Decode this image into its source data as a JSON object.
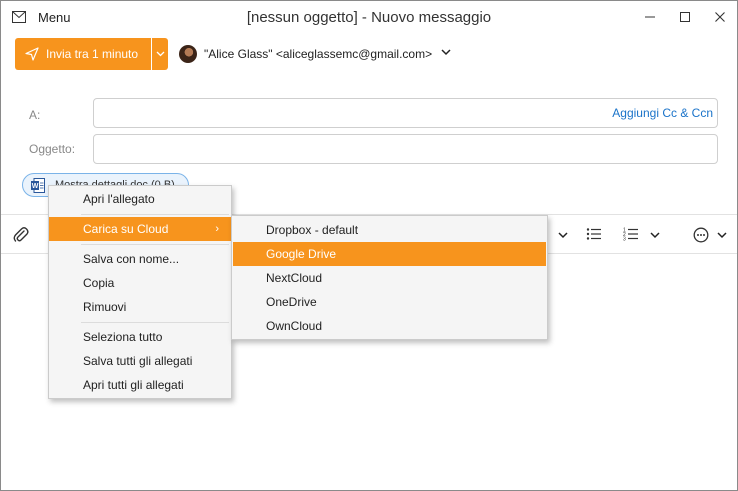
{
  "titlebar": {
    "menu_label": "Menu",
    "title": "[nessun oggetto] - Nuovo messaggio"
  },
  "toolbar": {
    "send_label": "Invia tra 1 minuto",
    "sender": "\"Alice Glass\" <aliceglassemc@gmail.com>"
  },
  "fields": {
    "to_label": "A:",
    "cc_link": "Aggiungi Cc & Ccn",
    "subject_label": "Oggetto:",
    "to_value": "",
    "subject_value": ""
  },
  "attachment": {
    "name": "Mostra dettagli doc (0 B)"
  },
  "context_menu": {
    "items": [
      {
        "label": "Apri l'allegato"
      },
      {
        "label": "Carica su Cloud",
        "has_submenu": true,
        "active": true
      },
      {
        "label": "Salva con nome..."
      },
      {
        "label": "Copia"
      },
      {
        "label": "Rimuovi"
      },
      {
        "label": "Seleziona tutto"
      },
      {
        "label": "Salva tutti gli allegati"
      },
      {
        "label": "Apri tutti gli allegati"
      }
    ],
    "submenu_arrow": "›"
  },
  "cloud_submenu": {
    "items": [
      {
        "label": "Dropbox - default"
      },
      {
        "label": "Google Drive",
        "active": true
      },
      {
        "label": "NextCloud"
      },
      {
        "label": "OneDrive"
      },
      {
        "label": "OwnCloud"
      }
    ]
  },
  "colors": {
    "accent": "#f7941d",
    "link": "#1a73c9"
  }
}
